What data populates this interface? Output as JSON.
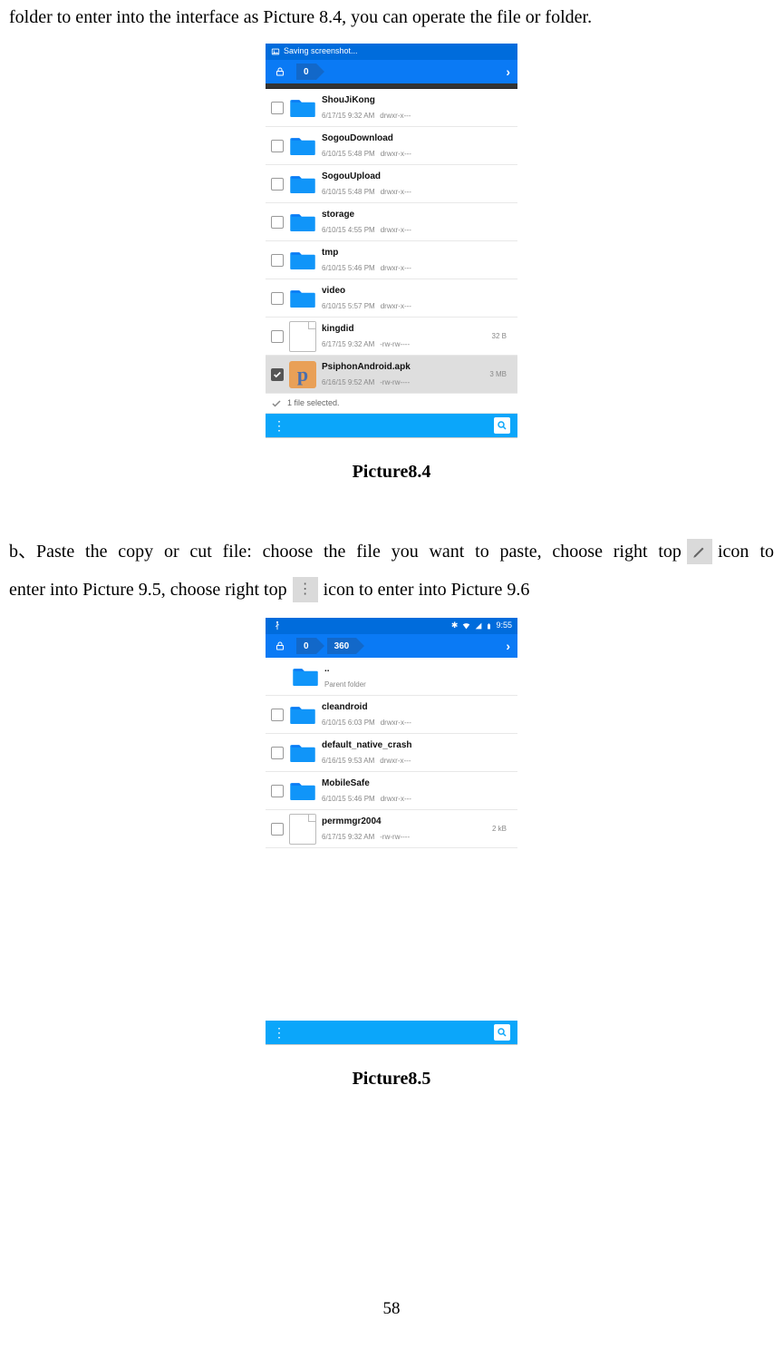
{
  "intro": "folder to enter into the interface as Picture 8.4, you can operate the file or folder.",
  "pic84": {
    "saving": "Saving screenshot...",
    "crumb": "0",
    "rows": [
      {
        "type": "folder",
        "name": "ShouJiKong",
        "date": "6/17/15 9:32 AM",
        "perm": "drwxr-x---"
      },
      {
        "type": "folder",
        "name": "SogouDownload",
        "date": "6/10/15 5:48 PM",
        "perm": "drwxr-x---"
      },
      {
        "type": "folder",
        "name": "SogouUpload",
        "date": "6/10/15 5:48 PM",
        "perm": "drwxr-x---"
      },
      {
        "type": "folder",
        "name": "storage",
        "date": "6/10/15 4:55 PM",
        "perm": "drwxr-x---"
      },
      {
        "type": "folder",
        "name": "tmp",
        "date": "6/10/15 5:46 PM",
        "perm": "drwxr-x---"
      },
      {
        "type": "folder",
        "name": "video",
        "date": "6/10/15 5:57 PM",
        "perm": "drwxr-x---"
      },
      {
        "type": "file",
        "name": "kingdid",
        "date": "6/17/15 9:32 AM",
        "perm": "-rw-rw----",
        "size": "32 B"
      },
      {
        "type": "apk",
        "name": "PsiphonAndroid.apk",
        "date": "6/16/15 9:52 AM",
        "perm": "-rw-rw----",
        "size": "3 MB",
        "selected": true
      }
    ],
    "selbar": "1 file selected.",
    "label": "Picture8.4"
  },
  "para_b": {
    "t1": "b、Paste the copy or cut file: choose the file you want to paste, choose right top",
    "t2": "icon to",
    "t3": "enter into Picture 9.5, choose right top",
    "t4": "icon to enter into Picture 9.6"
  },
  "p85": {
    "time": "9:55",
    "crumb1": "0",
    "crumb2": "360",
    "rows": [
      {
        "type": "folder",
        "name": "..",
        "meta": "Parent folder",
        "nocheck": true
      },
      {
        "type": "folder",
        "name": "cleandroid",
        "date": "6/10/15 6:03 PM",
        "perm": "drwxr-x---"
      },
      {
        "type": "folder",
        "name": "default_native_crash",
        "date": "6/16/15 9:53 AM",
        "perm": "drwxr-x---"
      },
      {
        "type": "folder",
        "name": "MobileSafe",
        "date": "6/10/15 5:46 PM",
        "perm": "drwxr-x---"
      },
      {
        "type": "file",
        "name": "permmgr2004",
        "date": "6/17/15 9:32 AM",
        "perm": "-rw-rw----",
        "size": "2 kB"
      }
    ],
    "label": "Picture8.5"
  },
  "page_number": "58"
}
